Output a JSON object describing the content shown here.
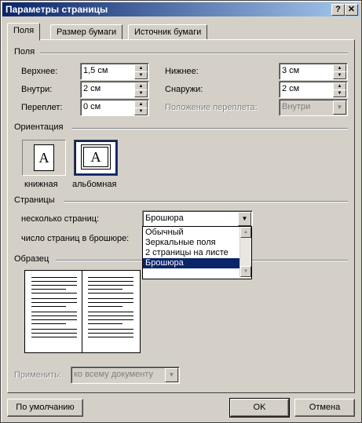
{
  "window": {
    "title": "Параметры страницы",
    "help_glyph": "?",
    "close_glyph": "✕"
  },
  "tabs": [
    {
      "label": "Поля",
      "active": true
    },
    {
      "label": "Размер бумаги",
      "active": false
    },
    {
      "label": "Источник бумаги",
      "active": false
    }
  ],
  "margins": {
    "section_label": "Поля",
    "top_label": "Верхнее:",
    "top_value": "1,5 см",
    "bottom_label": "Нижнее:",
    "bottom_value": "3 см",
    "inside_label": "Внутри:",
    "inside_value": "2 см",
    "outside_label": "Снаружи:",
    "outside_value": "2 см",
    "gutter_label": "Переплет:",
    "gutter_value": "0 см",
    "gutter_pos_label": "Положение переплета:",
    "gutter_pos_value": "Внутри"
  },
  "orientation": {
    "section_label": "Ориентация",
    "portrait_label": "книжная",
    "landscape_label": "альбомная",
    "icon_glyph": "A",
    "selected": "landscape"
  },
  "pages": {
    "section_label": "Страницы",
    "multiple_label": "несколько страниц:",
    "multiple_value": "Брошюра",
    "booklet_label": "число страниц в брошюре:",
    "options": [
      "Обычный",
      "Зеркальные поля",
      "2 страницы на листе",
      "Брошюра"
    ],
    "selected_option": "Брошюра"
  },
  "preview": {
    "section_label": "Образец"
  },
  "apply": {
    "label": "Применить:",
    "value": "ко всему документу"
  },
  "buttons": {
    "default": "По умолчанию",
    "ok": "OK",
    "cancel": "Отмена"
  },
  "colors": {
    "face": "#d4d0c8",
    "title_start": "#0a246a",
    "title_end": "#a6caf0",
    "selection": "#0a246a",
    "disabled": "#808080"
  },
  "icons": [
    "help-icon",
    "close-icon",
    "spin-up-icon",
    "spin-down-icon",
    "dropdown-arrow-icon",
    "scroll-up-icon",
    "scroll-down-icon"
  ]
}
